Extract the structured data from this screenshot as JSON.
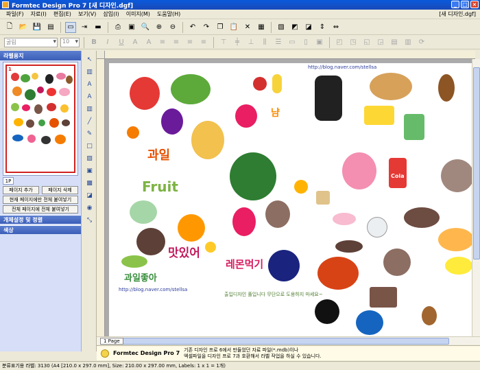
{
  "window": {
    "title": "Formtec Design Pro 7 [새 디자인.dgf]",
    "document": "[새 디자인.dgf]"
  },
  "menu": [
    "파일(F)",
    "자료(I)",
    "편집(E)",
    "보기(V)",
    "삽입(I)",
    "이미지(M)",
    "도움말(H)"
  ],
  "toolbar": {
    "font_name": "굴림",
    "font_size": "10"
  },
  "left_panel": {
    "thumbnail_header": "라벨용지",
    "page_number": "1",
    "page_label": "1P",
    "add_page": "페이지 추가",
    "delete_page": "페이지 삭제",
    "fill_current": "현재 페이지에만 전체 붙여넣기",
    "fill_all": "전체 페이지에 전체 붙여넣기",
    "section_object": "개체설정 및 정렬",
    "section_color": "색상"
  },
  "canvas": {
    "url_top": "http://blog.naver.com/stellsa",
    "url_bottom": "http://blog.naver.com/stellsa",
    "credit": "출입디자인 풀입니다 무단으로 도용하지 마세요~",
    "text_fruit": "Fruit",
    "text_gwail": "과일",
    "text_mat": "맛있어",
    "text_gwail_jota": "과일좋아",
    "text_lemon": "레몬먹기",
    "text_nam": "냠",
    "text_cola": "Cola"
  },
  "page_tab": "1 Page",
  "info": {
    "brand": "Formtec Design Pro 7",
    "line1": "기존 디자인 프로 6에서 만들었던 자료 파일(*.mdb)이나",
    "line2": "엑셀파일을 디자인 프로 7과 호환해서 라벨 작업을 하실 수 있습니다."
  },
  "status": "분류표기용 라벨: 3130 (A4 [210.0 x 297.0 mm], Size: 210.00 x 297.00 mm, Labels: 1 x 1 = 1개)",
  "colors": {
    "title_bar": "#0A5ADB",
    "panel_header": "#3B5EB8",
    "panel_bg": "#D6DFF7",
    "canvas_bg": "#ABABAB"
  }
}
